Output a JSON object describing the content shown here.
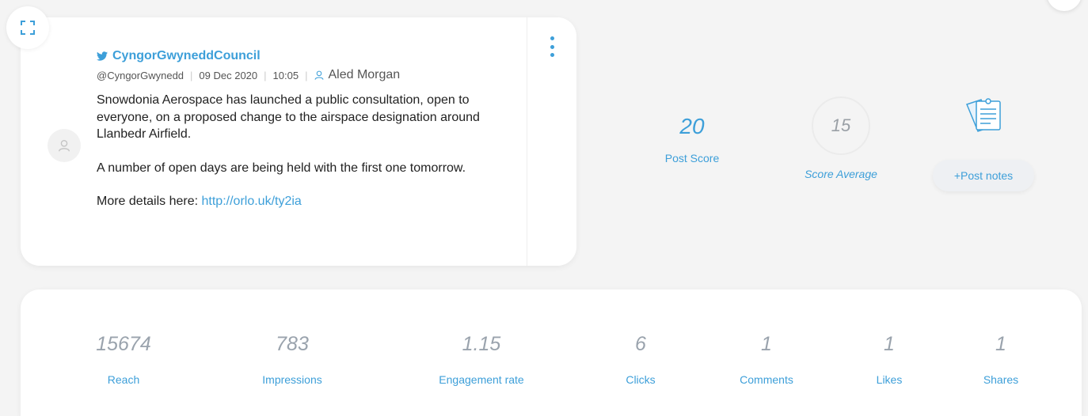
{
  "post": {
    "account_name": "CyngorGwyneddCouncil",
    "handle": "@CyngorGwynedd",
    "date": "09 Dec 2020",
    "time": "10:05",
    "author": "Aled Morgan",
    "paragraphs": [
      "Snowdonia Aerospace has launched a public consultation, open to everyone, on a proposed change to the airspace designation around Llanbedr Airfield.",
      "A number of open days are being held with the first one tomorrow."
    ],
    "details_prefix": "More details here: ",
    "link": "http://orlo.uk/ty2ia"
  },
  "scores": {
    "post_score_value": "20",
    "post_score_label": "Post Score",
    "average_value": "15",
    "average_label": "Score Average",
    "notes_button": "+Post notes"
  },
  "metrics": [
    {
      "value": "15674",
      "label": "Reach"
    },
    {
      "value": "783",
      "label": "Impressions"
    },
    {
      "value": "1.15",
      "label": "Engagement rate"
    },
    {
      "value": "6",
      "label": "Clicks"
    },
    {
      "value": "1",
      "label": "Comments"
    },
    {
      "value": "1",
      "label": "Likes"
    },
    {
      "value": "1",
      "label": "Shares"
    }
  ],
  "icons": {
    "expand": "expand-icon",
    "menu": "kebab-menu-icon",
    "avatar": "user-avatar-icon",
    "twitter": "twitter-icon",
    "author": "user-icon",
    "notes": "notes-icon"
  },
  "colors": {
    "accent": "#3d9fd9",
    "muted_value": "#9aa3ad"
  }
}
